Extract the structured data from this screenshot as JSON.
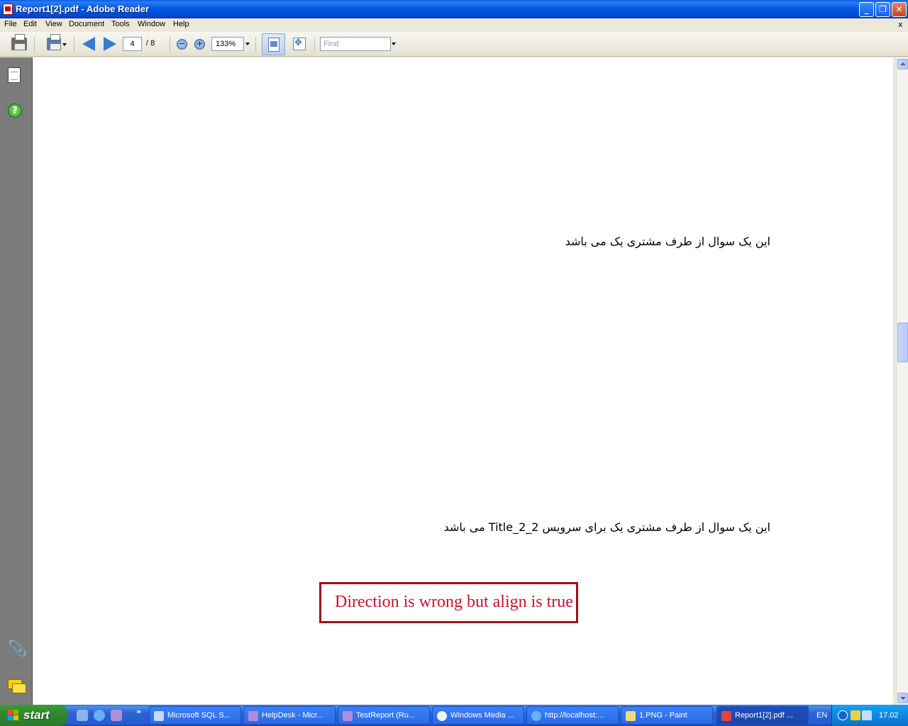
{
  "window": {
    "title": "Report1[2].pdf - Adobe Reader",
    "min_glyph": "_",
    "max_glyph": "❐",
    "close_glyph": "✕"
  },
  "menu": [
    "File",
    "Edit",
    "View",
    "Document",
    "Tools",
    "Window",
    "Help"
  ],
  "menu_close_glyph": "x",
  "toolbar": {
    "page_current": "4",
    "page_total": "/ 8",
    "zoom_out_glyph": "−",
    "zoom_in_glyph": "+",
    "zoom_value": "133%",
    "find_placeholder": "Find"
  },
  "nav_icons": [
    "pages-icon",
    "help-icon",
    "attachments-icon",
    "comments-icon"
  ],
  "nav_help_glyph": "?",
  "nav_clip_glyph": "📎",
  "document": {
    "line1": "این یک سوال از طرف مشتری یک می باشد",
    "line2": "این یک سوال از طرف مشتری یک برای سرویس Title_2_2 می باشد",
    "annotation": "Direction is wrong but align is true"
  },
  "colors": {
    "annotation_border": "#a00f1f",
    "annotation_text": "#c8102e",
    "nav_pane": "#7b7b7b",
    "taskbar": "#245dd7",
    "start_green": "#2f8a2f"
  },
  "taskbar": {
    "start_label": "start",
    "quick_chevron": "»",
    "tasks": [
      {
        "label": "Microsoft SQL S...",
        "icon": "sql-server-icon",
        "icolor": "#c8d8f8"
      },
      {
        "label": "HelpDesk - Micr...",
        "icon": "visual-studio-icon",
        "icolor": "#b08cd8"
      },
      {
        "label": "TestReport (Ru...",
        "icon": "visual-studio-icon",
        "icolor": "#b08cd8"
      },
      {
        "label": "Windows Media ...",
        "icon": "media-player-icon",
        "icolor": "#f0f0f0"
      },
      {
        "label": "http://localhost:...",
        "icon": "internet-explorer-icon",
        "icolor": "#6ab0f0"
      },
      {
        "label": "1.PNG - Paint",
        "icon": "paint-icon",
        "icolor": "#f8d870"
      },
      {
        "label": "Report1[2].pdf ...",
        "icon": "adobe-reader-icon",
        "icolor": "#e84040",
        "active": true
      }
    ],
    "language": "EN",
    "clock": "17.02"
  }
}
